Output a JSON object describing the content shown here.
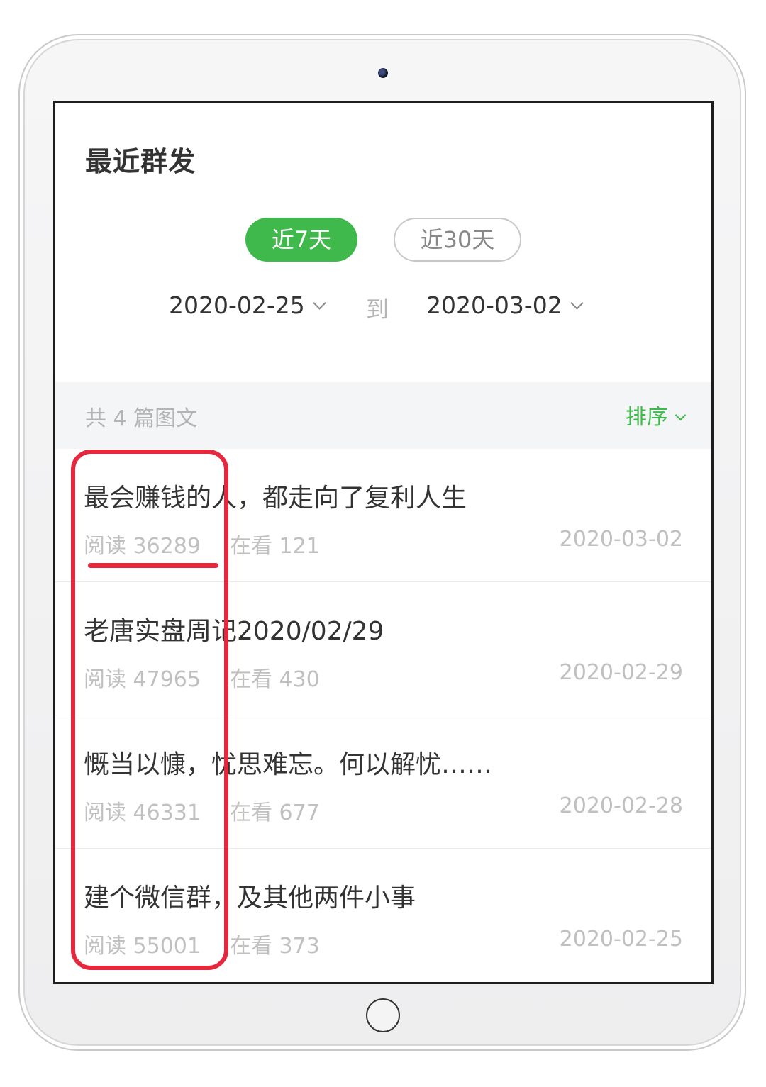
{
  "header": {
    "title": "最近群发"
  },
  "range_filter": {
    "options": [
      {
        "label": "近7天",
        "selected": true
      },
      {
        "label": "近30天",
        "selected": false
      }
    ]
  },
  "date_range": {
    "start": "2020-02-25",
    "separator": "到",
    "end": "2020-03-02"
  },
  "summary": {
    "count_text": "共 4 篇图文",
    "sort_label": "排序"
  },
  "articles": [
    {
      "title": "最会赚钱的人，都走向了复利人生",
      "reads": "阅读 36289",
      "watching": "在看 121",
      "date": "2020-03-02"
    },
    {
      "title": "老唐实盘周记2020/02/29",
      "reads": "阅读 47965",
      "watching": "在看 430",
      "date": "2020-02-29"
    },
    {
      "title": "慨当以慷，忧思难忘。何以解忧……",
      "reads": "阅读 46331",
      "watching": "在看 677",
      "date": "2020-02-28"
    },
    {
      "title": "建个微信群，及其他两件小事",
      "reads": "阅读 55001",
      "watching": "在看 373",
      "date": "2020-02-25"
    }
  ],
  "colors": {
    "accent": "#3fb94c",
    "annotation": "#e5283e"
  }
}
